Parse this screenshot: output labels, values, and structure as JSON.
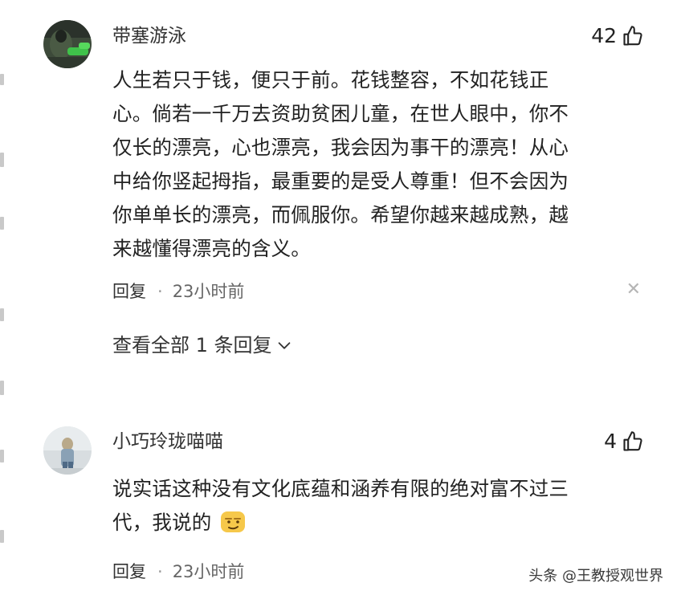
{
  "comments": [
    {
      "username": "带塞游泳",
      "likes": "42",
      "lines": [
        "人生若只于钱，便只于前。花钱整容，不如花钱正",
        "心。倘若一千万去资助贫困儿童，在世人眼中，你不",
        "仅长的漂亮，心也漂亮，我会因为事干的漂亮！从心",
        "中给你竖起拇指，最重要的是受人尊重！但不会因为",
        "你单单长的漂亮，而佩服你。希望你越来越成熟，越",
        "来越懂得漂亮的含义。"
      ],
      "reply_label": "回复",
      "separator": "·",
      "time": "23小时前",
      "view_replies_label": "查看全部 1 条回复",
      "avatar_icon": "user-avatar-photo",
      "close_icon": "close-icon",
      "like_icon": "thumbs-up-icon"
    },
    {
      "username": "小巧玲珑喵喵",
      "likes": "4",
      "lines": [
        "说实话这种没有文化底蕴和涵养有限的绝对富不过三",
        "代，我说的"
      ],
      "reply_label": "回复",
      "separator": "·",
      "time": "23小时前",
      "avatar_icon": "user-avatar-photo",
      "like_icon": "thumbs-up-icon",
      "emoji_icon": "smug-face-emoji-icon"
    }
  ],
  "watermark": "头条 @王教授观世界",
  "colors": {
    "text": "#222222",
    "meta": "#666666",
    "close": "#b5b5b5",
    "background": "#ffffff"
  }
}
